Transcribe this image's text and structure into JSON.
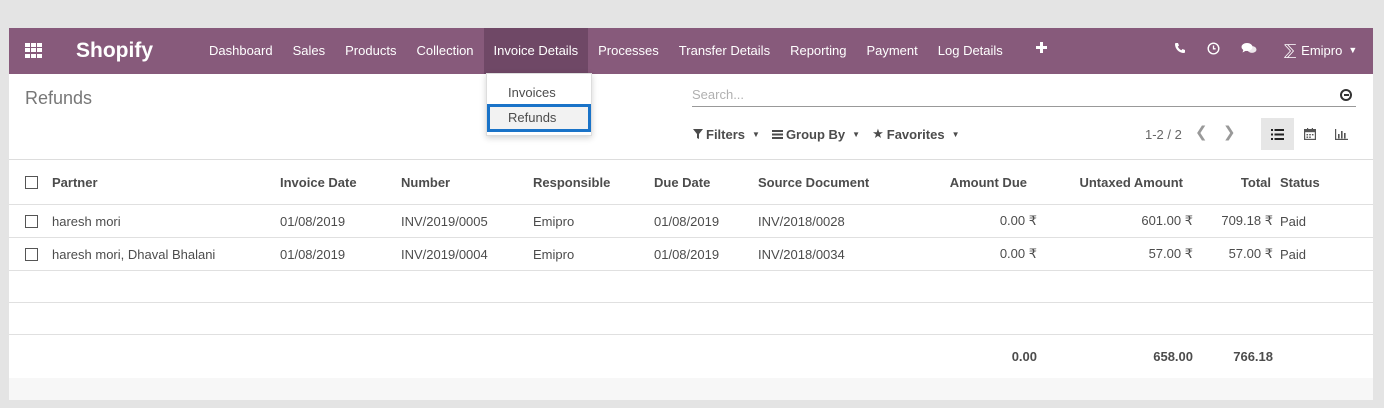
{
  "app": {
    "brand": "Shopify"
  },
  "nav": {
    "items": [
      "Dashboard",
      "Sales",
      "Products",
      "Collection",
      "Invoice Details",
      "Processes",
      "Transfer Details",
      "Reporting",
      "Payment",
      "Log Details"
    ],
    "active": "Invoice Details",
    "user": "Emipro",
    "icons": [
      "phone-icon",
      "clock-icon",
      "chat-icon",
      "plus-icon"
    ]
  },
  "dropdown": {
    "items": [
      "Invoices",
      "Refunds"
    ],
    "selected": "Refunds"
  },
  "page": {
    "title": "Refunds"
  },
  "search": {
    "placeholder": "Search..."
  },
  "filters": {
    "filters_label": "Filters",
    "groupby_label": "Group By",
    "favorites_label": "Favorites"
  },
  "pager": {
    "text": "1-2 / 2"
  },
  "table": {
    "headers": {
      "partner": "Partner",
      "invoice_date": "Invoice Date",
      "number": "Number",
      "responsible": "Responsible",
      "due_date": "Due Date",
      "source_document": "Source Document",
      "amount_due": "Amount Due",
      "untaxed_amount": "Untaxed Amount",
      "total": "Total",
      "status": "Status"
    },
    "rows": [
      {
        "partner": "haresh mori",
        "invoice_date": "01/08/2019",
        "number": "INV/2019/0005",
        "responsible": "Emipro",
        "due_date": "01/08/2019",
        "source_document": "INV/2018/0028",
        "amount_due": "0.00 ₹",
        "untaxed_amount": "601.00 ₹",
        "total": "709.18 ₹",
        "status": "Paid"
      },
      {
        "partner": "haresh mori, Dhaval Bhalani",
        "invoice_date": "01/08/2019",
        "number": "INV/2019/0004",
        "responsible": "Emipro",
        "due_date": "01/08/2019",
        "source_document": "INV/2018/0034",
        "amount_due": "0.00 ₹",
        "untaxed_amount": "57.00 ₹",
        "total": "57.00 ₹",
        "status": "Paid"
      }
    ],
    "totals": {
      "amount_due": "0.00",
      "untaxed_amount": "658.00",
      "total": "766.18"
    }
  }
}
